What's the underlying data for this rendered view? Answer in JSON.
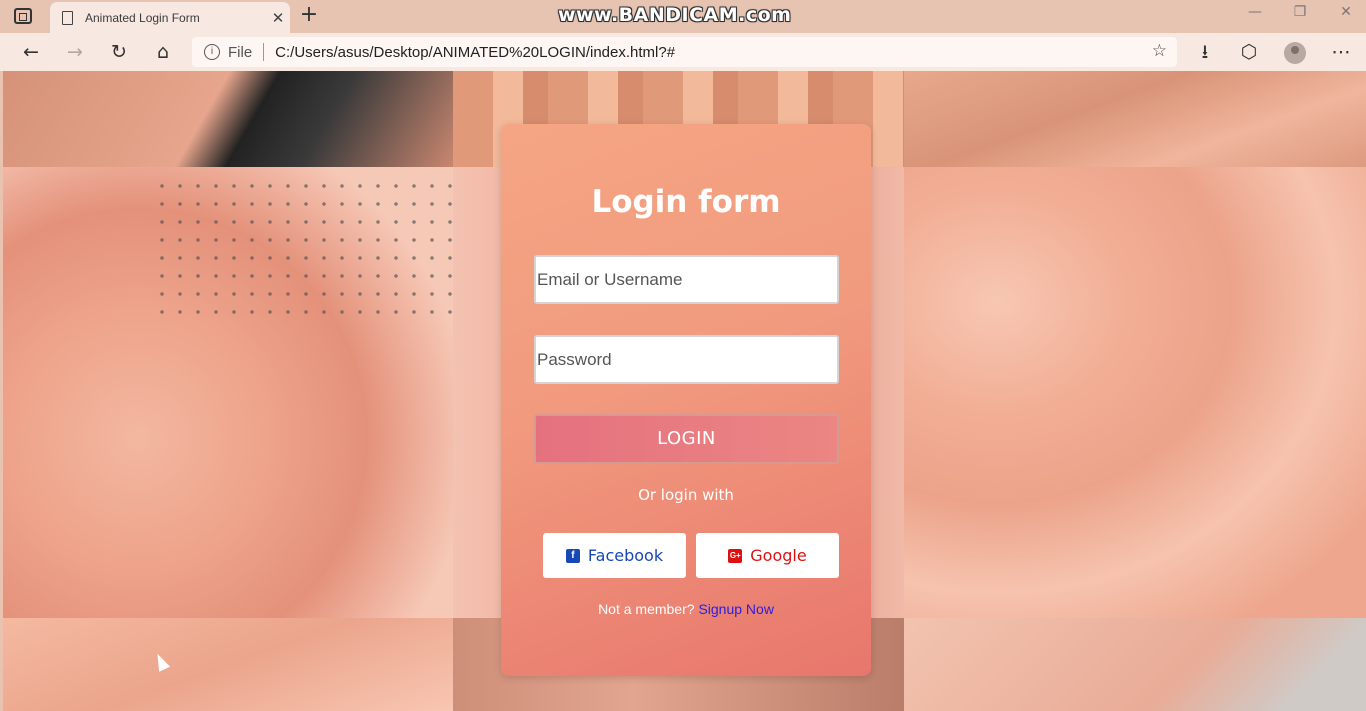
{
  "browser": {
    "tab_title": "Animated Login Form",
    "tab_close": "✕",
    "new_tab": "+",
    "scheme_label": "File",
    "url": "C:/Users/asus/Desktop/ANIMATED%20LOGIN/index.html?#",
    "watermark": "www.BANDICAM.com",
    "window_controls": {
      "minimize": "—",
      "restore": "❐",
      "close": "✕"
    },
    "toolbar": {
      "back": "←",
      "forward": "→",
      "refresh": "↻",
      "home": "⌂",
      "favorite": "☆",
      "downloads": "⭳",
      "extensions": "⬡",
      "more": "⋯"
    }
  },
  "login": {
    "title": "Login form",
    "email_placeholder": "Email or Username",
    "password_placeholder": "Password",
    "login_button": "LOGIN",
    "or_text": "Or login with",
    "facebook_label": "Facebook",
    "google_label": "Google",
    "facebook_icon": "f",
    "google_icon": "G+",
    "member_text": "Not a member?",
    "signup_link": "Signup Now"
  },
  "colors": {
    "card_gradient_start": "#f5a584",
    "card_gradient_end": "#e8766c",
    "login_button": "#e5717f",
    "facebook": "#1648b8",
    "google": "#dd1111",
    "signup_link": "#2a1ee0"
  }
}
